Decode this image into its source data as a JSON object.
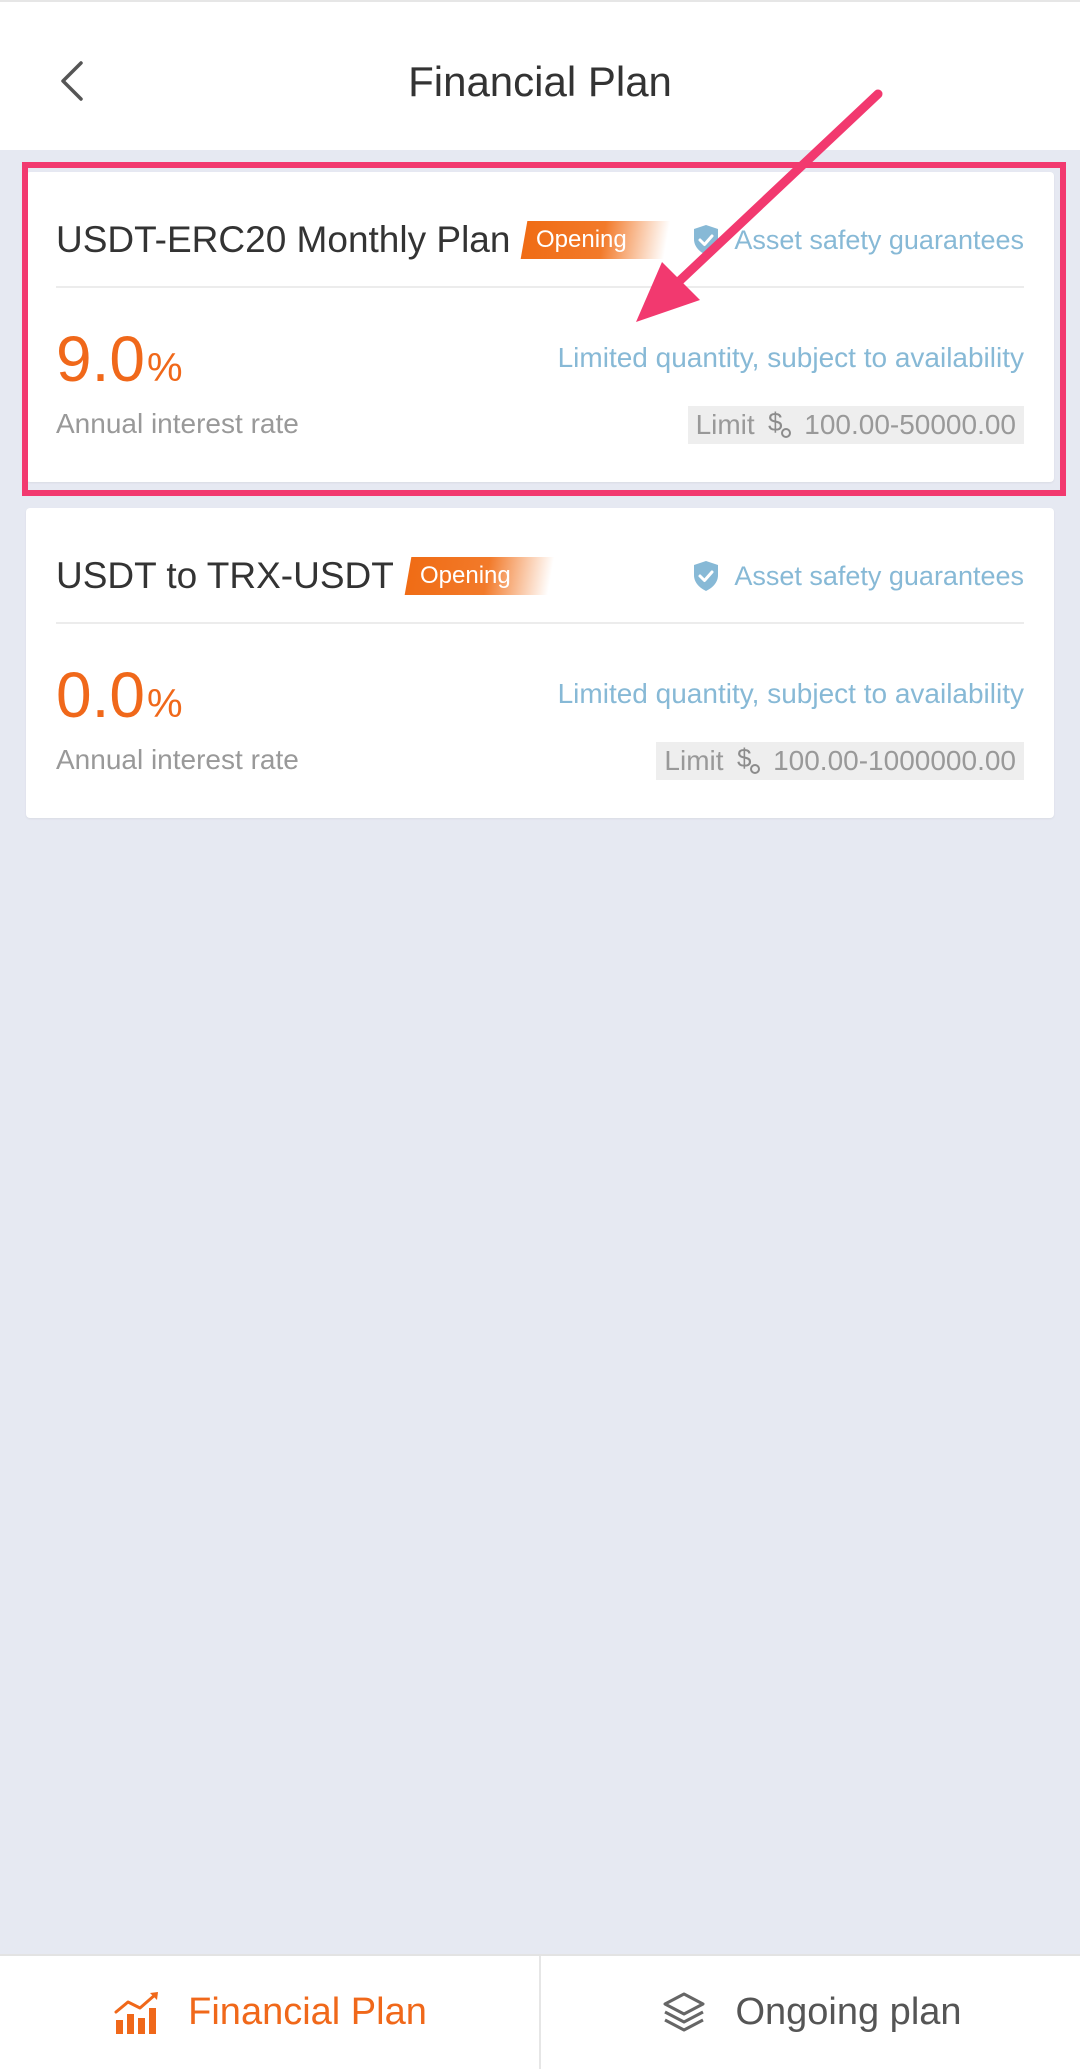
{
  "header": {
    "title": "Financial Plan",
    "back_icon": "chevron-left-icon"
  },
  "plans": [
    {
      "name": "USDT-ERC20 Monthly Plan",
      "status": "Opening",
      "safety_text": "Asset safety guarantees",
      "rate_value": "9.0",
      "rate_unit": "%",
      "rate_label": "Annual interest rate",
      "availability": "Limited quantity, subject to availability",
      "limit_prefix": "Limit",
      "limit_range": "100.00-50000.00"
    },
    {
      "name": "USDT to TRX-USDT",
      "status": "Opening",
      "safety_text": "Asset safety guarantees",
      "rate_value": "0.0",
      "rate_unit": "%",
      "rate_label": "Annual interest rate",
      "availability": "Limited quantity, subject to availability",
      "limit_prefix": "Limit",
      "limit_range": "100.00-1000000.00"
    }
  ],
  "tabbar": {
    "tabs": [
      {
        "label": "Financial Plan",
        "icon": "bar-chart-icon",
        "active": true
      },
      {
        "label": "Ongoing plan",
        "icon": "layers-icon",
        "active": false
      }
    ]
  },
  "colors": {
    "accent": "#f0681a",
    "info": "#87b9d6",
    "highlight": "#f2396f",
    "background": "#e6e9f2"
  }
}
